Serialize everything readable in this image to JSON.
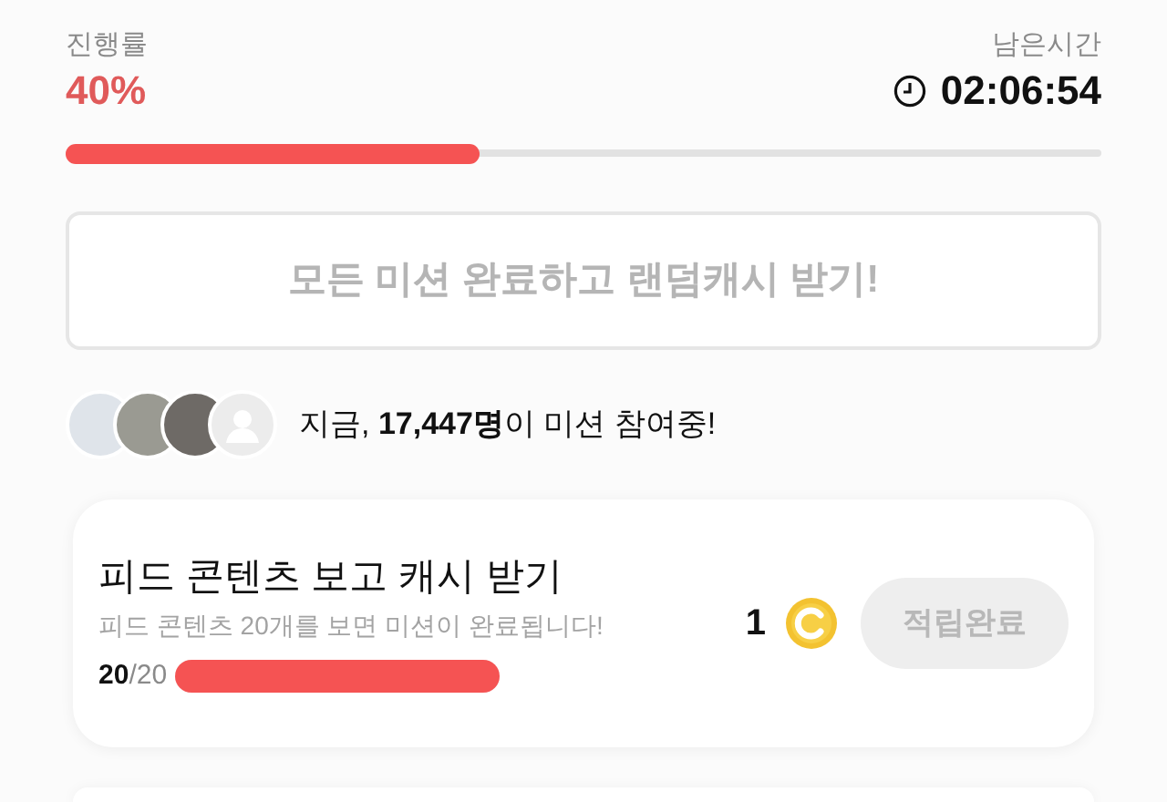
{
  "progress": {
    "label": "진행률",
    "value": "40%",
    "level": 0.4
  },
  "time_left": {
    "label": "남은시간",
    "value": "02:06:54"
  },
  "banner": {
    "text": "모든 미션 완료하고 랜덤캐시 받기!"
  },
  "participants": {
    "avatars": [
      {
        "kind": "photo"
      },
      {
        "kind": "photo"
      },
      {
        "kind": "photo"
      },
      {
        "kind": "silhouette"
      }
    ],
    "text": "지금, **17,447명**이 미션 참여중!"
  },
  "missions": [
    {
      "title": "피드 콘텐츠 보고 캐시 받기",
      "description": "피드 콘텐츠 20개를 보면 미션이 완료됩니다!",
      "count": "**20**/20",
      "level": 1,
      "reward": "1",
      "button": "적립완료",
      "disabled": true
    }
  ]
}
